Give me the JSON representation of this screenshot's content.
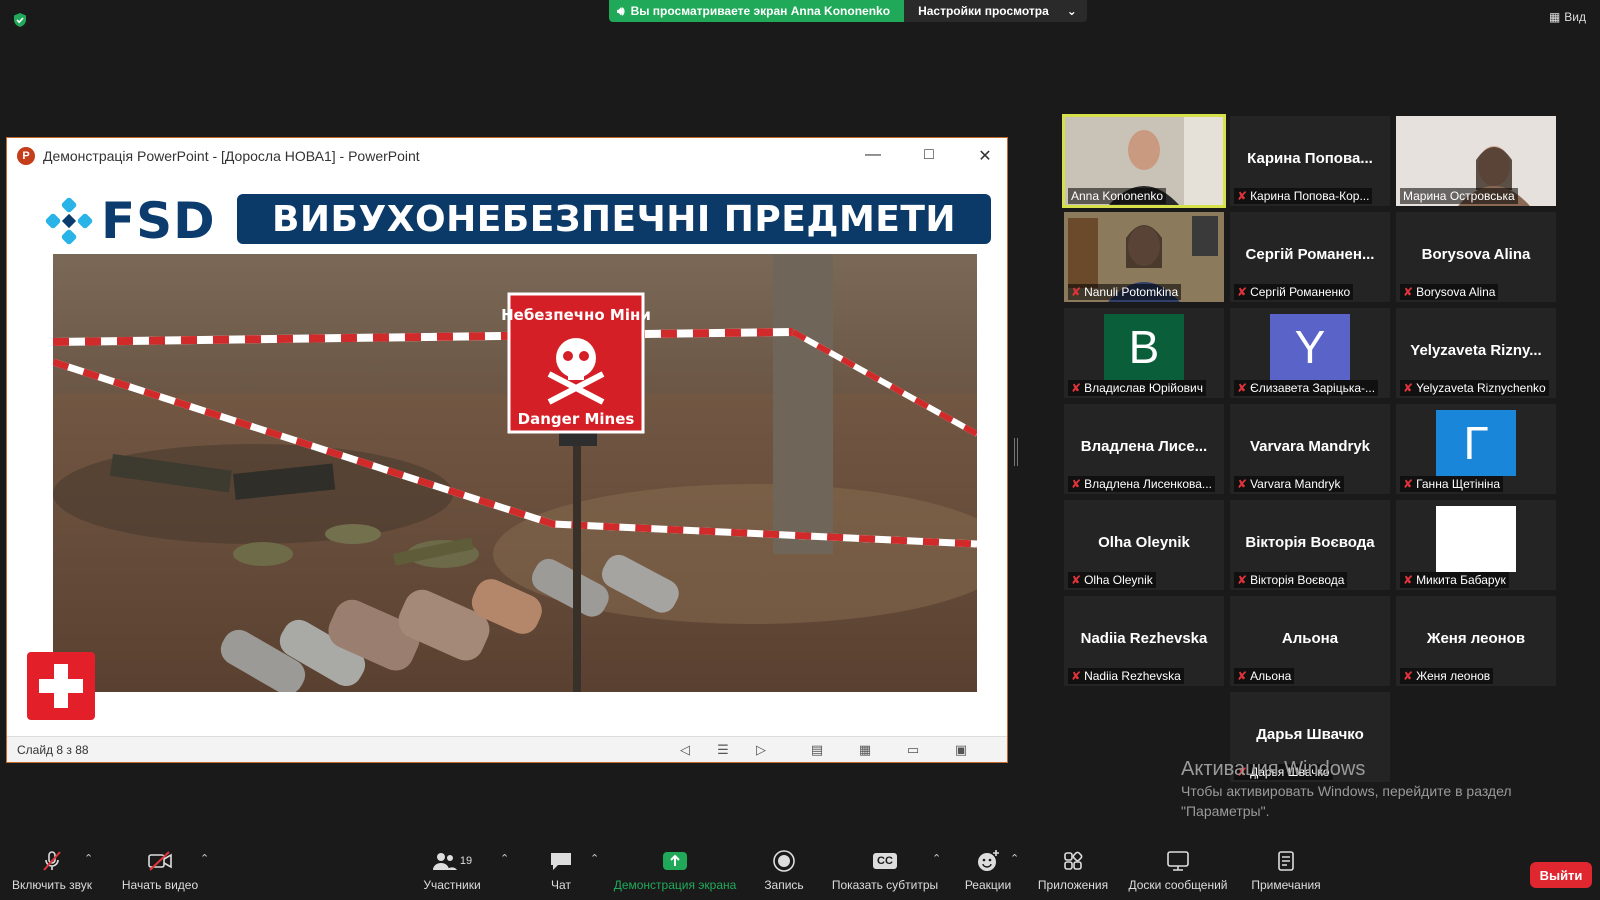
{
  "top": {
    "viewing_text": "Вы просматриваете экран Anna Kononenko",
    "settings_label": "Настройки просмотра",
    "view_label": "Вид"
  },
  "ppt": {
    "window_title": "Демонстрація PowerPoint - [Доросла НОВА1] - PowerPoint",
    "logo_letter": "P",
    "slide_logo": "FSD",
    "slide_banner": "ВИБУХОНЕБЕЗПЕЧНІ ПРЕДМЕТИ",
    "sign_top": "Небезпечно Міни",
    "sign_bottom": "Danger Mines",
    "status": "Слайд 8 з 88"
  },
  "gallery": [
    {
      "center": "",
      "name": "Anna Kononenko",
      "muted": false,
      "kind": "video1"
    },
    {
      "center": "Карина Попова...",
      "name": "Карина Попова-Кор...",
      "muted": true,
      "kind": "text"
    },
    {
      "center": "",
      "name": "Марина Островська",
      "muted": false,
      "kind": "video2"
    },
    {
      "center": "",
      "name": "Nanuli Potomkina",
      "muted": true,
      "kind": "video3"
    },
    {
      "center": "Сергій Романен...",
      "name": "Сергій Романенко",
      "muted": true,
      "kind": "text"
    },
    {
      "center": "Borysova Alina",
      "name": "Borysova Alina",
      "muted": true,
      "kind": "text"
    },
    {
      "center": "B",
      "name": "Владислав Юрійович",
      "muted": true,
      "kind": "avatar",
      "color": "#0b5e3a"
    },
    {
      "center": "Y",
      "name": "Єлизавета Зарiцька-...",
      "muted": true,
      "kind": "avatar",
      "color": "#5a63c8"
    },
    {
      "center": "Yelyzaveta Rizny...",
      "name": "Yelyzaveta Riznychenko",
      "muted": true,
      "kind": "text"
    },
    {
      "center": "Владлена Лисе...",
      "name": "Владлена Лисенкова...",
      "muted": true,
      "kind": "text"
    },
    {
      "center": "Varvara Mandryk",
      "name": "Varvara Mandryk",
      "muted": true,
      "kind": "text"
    },
    {
      "center": "Г",
      "name": "Ганна Щетініна",
      "muted": true,
      "kind": "avatar",
      "color": "#1a86d9"
    },
    {
      "center": "Olha Oleynik",
      "name": "Olha Oleynik",
      "muted": true,
      "kind": "text"
    },
    {
      "center": "Вікторія Воєвода",
      "name": "Вікторія Воєвода",
      "muted": true,
      "kind": "text"
    },
    {
      "center": "",
      "name": "Микита Бабарук",
      "muted": true,
      "kind": "avatar",
      "color": "#ffffff"
    },
    {
      "center": "Nadiia Rezhevska",
      "name": "Nadiia Rezhevska",
      "muted": true,
      "kind": "text"
    },
    {
      "center": "Альона",
      "name": "Альона",
      "muted": true,
      "kind": "text"
    },
    {
      "center": "Женя леонов",
      "name": "Женя леонов",
      "muted": true,
      "kind": "text"
    },
    {
      "center": "Дарья Швачко",
      "name": "Дарья Швачко",
      "muted": true,
      "kind": "text"
    }
  ],
  "activation": {
    "title": "Активация Windows",
    "line1": "Чтобы активировать Windows, перейдите в раздел",
    "line2": "\"Параметры\"."
  },
  "toolbar": {
    "mute": "Включить звук",
    "video": "Начать видео",
    "participants": "Участники",
    "participants_count": "19",
    "chat": "Чат",
    "share": "Демонстрация экрана",
    "record": "Запись",
    "captions": "Показать субтитры",
    "captions_icon_text": "CC",
    "reactions": "Реакции",
    "apps": "Приложения",
    "boards": "Доски сообщений",
    "notes": "Примечания",
    "leave": "Выйти"
  },
  "colors": {
    "share_green": "#21a95a",
    "leave_red": "#e0262e",
    "active_speaker": "#d6e04a",
    "fsd_blue": "#0c3c6e"
  }
}
